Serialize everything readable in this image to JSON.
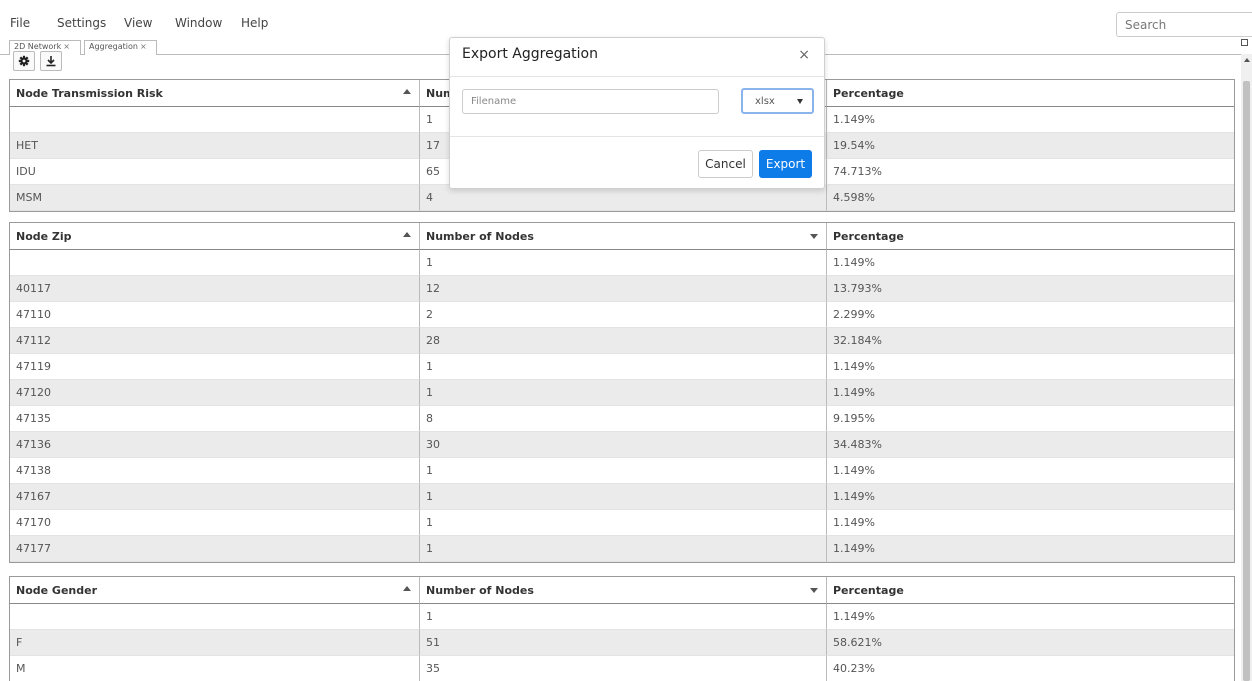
{
  "menu": {
    "file": "File",
    "settings": "Settings",
    "view": "View",
    "window": "Window",
    "help": "Help"
  },
  "search": {
    "placeholder": "Search"
  },
  "tabs": [
    {
      "label": "2D Network",
      "close": "×"
    },
    {
      "label": "Aggregation",
      "close": "×"
    }
  ],
  "toolbar": {
    "settings_icon": "gear-icon",
    "download_icon": "download-icon"
  },
  "tables": [
    {
      "headers": [
        "Node Transmission Risk",
        "Num",
        "Percentage"
      ],
      "rows": [
        [
          "",
          "1",
          "1.149%"
        ],
        [
          "HET",
          "17",
          "19.54%"
        ],
        [
          "IDU",
          "65",
          "74.713%"
        ],
        [
          "MSM",
          "4",
          "4.598%"
        ]
      ]
    },
    {
      "headers": [
        "Node Zip",
        "Number of Nodes",
        "Percentage"
      ],
      "rows": [
        [
          "",
          "1",
          "1.149%"
        ],
        [
          "40117",
          "12",
          "13.793%"
        ],
        [
          "47110",
          "2",
          "2.299%"
        ],
        [
          "47112",
          "28",
          "32.184%"
        ],
        [
          "47119",
          "1",
          "1.149%"
        ],
        [
          "47120",
          "1",
          "1.149%"
        ],
        [
          "47135",
          "8",
          "9.195%"
        ],
        [
          "47136",
          "30",
          "34.483%"
        ],
        [
          "47138",
          "1",
          "1.149%"
        ],
        [
          "47167",
          "1",
          "1.149%"
        ],
        [
          "47170",
          "1",
          "1.149%"
        ],
        [
          "47177",
          "1",
          "1.149%"
        ]
      ]
    },
    {
      "headers": [
        "Node Gender",
        "Number of Nodes",
        "Percentage"
      ],
      "rows": [
        [
          "",
          "1",
          "1.149%"
        ],
        [
          "F",
          "51",
          "58.621%"
        ],
        [
          "M",
          "35",
          "40.23%"
        ]
      ]
    }
  ],
  "modal": {
    "title": "Export Aggregation",
    "close": "×",
    "filename_placeholder": "Filename",
    "format": "xlsx",
    "cancel": "Cancel",
    "export": "Export"
  },
  "colors": {
    "accent": "#0d7be8",
    "row_alt": "#ebebeb",
    "focus_border": "#8ab4ec"
  }
}
